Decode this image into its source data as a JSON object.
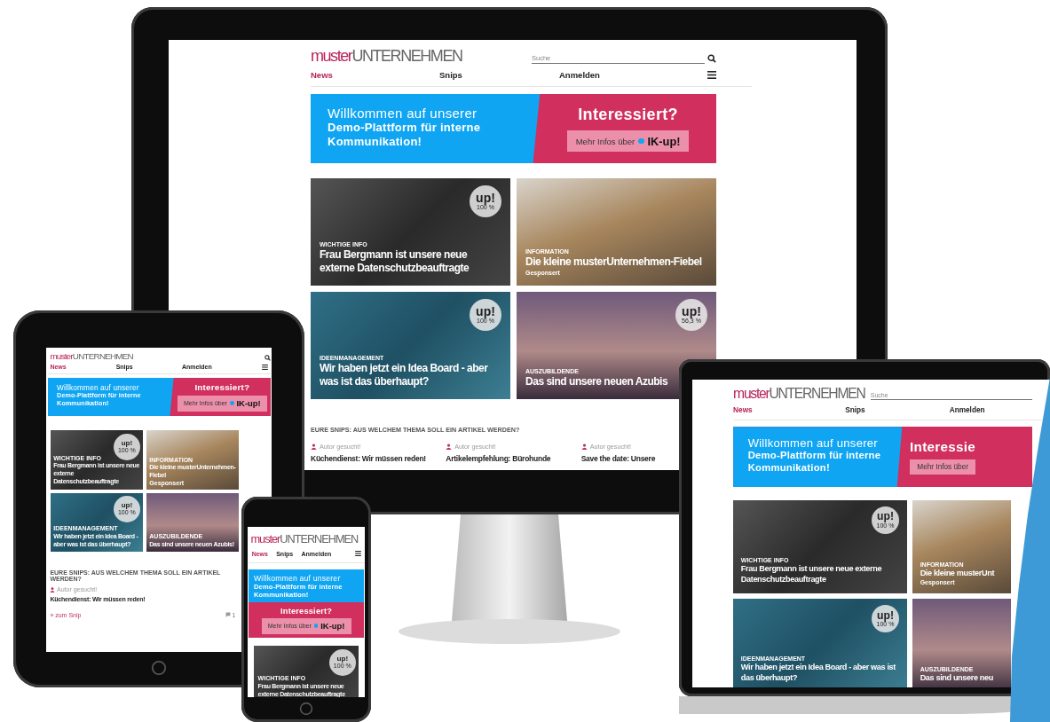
{
  "devices": [
    {
      "kind": "desktop",
      "logo": {
        "prefix": "muster",
        "suffix": "UNTERNEHMEN"
      },
      "search": {
        "placeholder": "Suche"
      },
      "nav": [
        {
          "label": "News",
          "selected": true
        },
        {
          "label": "Snips",
          "selected": false
        },
        {
          "label": "Anmelden",
          "selected": false
        }
      ],
      "banner": {
        "welcome": "Willkommen auf unserer",
        "headline": "Demo-Plattform für interne Kommunikation!",
        "cta_title": "Interessiert?",
        "cta_button": "Mehr Infos über",
        "brand": "IK-up!"
      },
      "cards": [
        {
          "category": "WICHTIGE INFO",
          "title": "Frau Bergmann ist unsere neue externe Datenschutzbeauftragte",
          "badge": {
            "label": "up!",
            "percent": "100 %"
          }
        },
        {
          "category": "INFORMATION",
          "title": "Die kleine musterUnternehmen-Fiebel",
          "sponsor": "Gesponsert"
        },
        {
          "category": "IDEENMANAGEMENT",
          "title": "Wir haben jetzt ein Idea Board - aber was ist das überhaupt?",
          "badge": {
            "label": "up!",
            "percent": "100 %"
          }
        },
        {
          "category": "AUSZUBILDENDE",
          "title": "Das sind unsere neuen Azubis",
          "badge": {
            "label": "up!",
            "percent": "56,3 %"
          }
        }
      ],
      "snips": {
        "heading": "EURE SNIPS: AUS WELCHEM THEMA SOLL EIN ARTIKEL WERDEN?",
        "items": [
          {
            "author": "Autor gesucht!",
            "title": "Küchendienst: Wir müssen reden!"
          },
          {
            "author": "Autor gesucht!",
            "title": "Artikelempfehlung: Bürohunde"
          },
          {
            "author": "Autor gesucht!",
            "title": "Save the date: Unsere"
          }
        ]
      }
    },
    {
      "kind": "tablet",
      "logo": {
        "prefix": "muster",
        "suffix": "UNTERNEHMEN"
      },
      "nav": [
        {
          "label": "News",
          "selected": true
        },
        {
          "label": "Snips",
          "selected": false
        },
        {
          "label": "Anmelden",
          "selected": false
        }
      ],
      "banner": {
        "welcome": "Willkommen auf unserer",
        "headline": "Demo-Plattform für interne Kommunikation!",
        "cta_title": "Interessiert?",
        "cta_button": "Mehr Infos über",
        "brand": "IK-up!"
      },
      "cards": [
        {
          "category": "WICHTIGE INFO",
          "title": "Frau Bergmann ist unsere neue externe Datenschutzbeauftragte",
          "badge": {
            "label": "up!",
            "percent": "100 %"
          }
        },
        {
          "category": "INFORMATION",
          "title": "Die kleine musterUnternehmen-Fiebel",
          "sponsor": "Gesponsert"
        },
        {
          "category": "IDEENMANAGEMENT",
          "title": "Wir haben jetzt ein Idea Board - aber was ist das überhaupt?",
          "badge": {
            "label": "up!",
            "percent": "100 %"
          }
        },
        {
          "category": "AUSZUBILDENDE",
          "title": "Das sind unsere neuen Azubis!"
        }
      ],
      "snips": {
        "heading": "EURE SNIPS: AUS WELCHEM THEMA SOLL EIN ARTIKEL WERDEN?",
        "items": [
          {
            "author": "Autor gesucht!",
            "title": "Küchendienst: Wir müssen reden!",
            "link": "» zum Snip",
            "count": "1"
          }
        ]
      }
    },
    {
      "kind": "phone",
      "logo": {
        "prefix": "muster",
        "suffix": "UNTERNEHMEN"
      },
      "nav": [
        {
          "label": "News",
          "selected": true
        },
        {
          "label": "Snips",
          "selected": false
        },
        {
          "label": "Anmelden",
          "selected": false
        }
      ],
      "banner": {
        "welcome": "Willkommen auf unserer",
        "headline": "Demo-Plattform für interne Kommunikation!",
        "cta_title": "Interessiert?",
        "cta_button": "Mehr Infos über",
        "brand": "IK-up!"
      },
      "cards": [
        {
          "category": "WICHTIGE INFO",
          "title": "Frau Bergmann ist unsere neue externe Datenschutzbeauftragte",
          "badge": {
            "label": "up!",
            "percent": "100 %"
          }
        }
      ]
    },
    {
      "kind": "laptop",
      "logo": {
        "prefix": "muster",
        "suffix": "UNTERNEHMEN"
      },
      "search": {
        "placeholder": "Suche"
      },
      "nav": [
        {
          "label": "News",
          "selected": true
        },
        {
          "label": "Snips",
          "selected": false
        },
        {
          "label": "Anmelden",
          "selected": false
        }
      ],
      "banner": {
        "welcome": "Willkommen auf unserer",
        "headline": "Demo-Plattform für interne Kommunikation!",
        "cta_title": "Interessie",
        "cta_button": "Mehr Infos über"
      },
      "cards": [
        {
          "category": "WICHTIGE INFO",
          "title": "Frau Bergmann ist unsere neue externe Datenschutzbeauftragte",
          "badge": {
            "label": "up!",
            "percent": "100 %"
          }
        },
        {
          "category": "INFORMATION",
          "title": "Die kleine musterUnt",
          "sponsor": "Gesponsert"
        },
        {
          "category": "IDEENMANAGEMENT",
          "title": "Wir haben jetzt ein Idea Board - aber was ist das überhaupt?",
          "badge": {
            "label": "up!",
            "percent": "100 %"
          }
        },
        {
          "category": "AUSZUBILDENDE",
          "title": "Das sind unsere neu"
        }
      ]
    }
  ]
}
